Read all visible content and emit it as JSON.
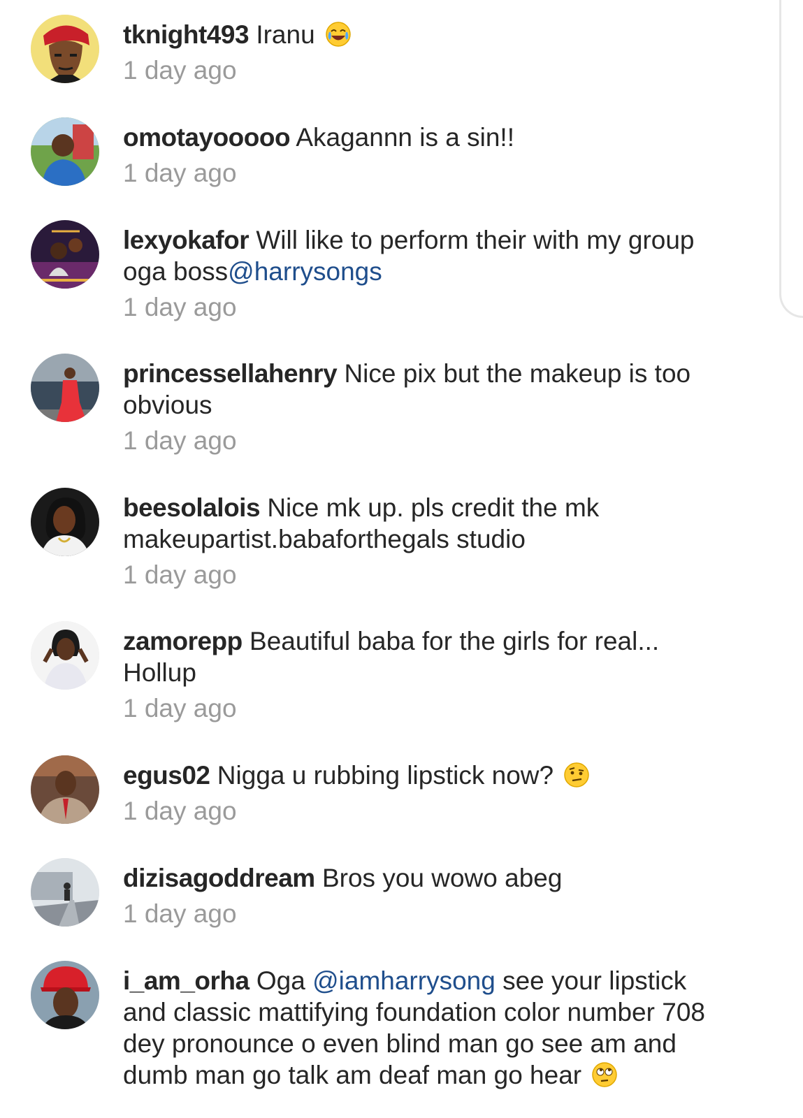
{
  "comments": [
    {
      "username": "tknight493",
      "text_before": "Iranu",
      "mention": "",
      "text_after": "",
      "emoji": "tears-of-joy-icon",
      "time": "1 day ago"
    },
    {
      "username": "omotayooooo",
      "text_before": "Akagannn is a sin!!",
      "mention": "",
      "text_after": "",
      "emoji": "",
      "time": "1 day ago"
    },
    {
      "username": "lexyokafor",
      "text_before": "Will like to perform their with my group oga boss",
      "mention": "@harrysongs",
      "text_after": "",
      "emoji": "",
      "time": "1 day ago"
    },
    {
      "username": "princessellahenry",
      "text_before": "Nice pix but the makeup is too obvious",
      "mention": "",
      "text_after": "",
      "emoji": "",
      "time": "1 day ago"
    },
    {
      "username": "beesolalois",
      "text_before": "Nice mk up. pls credit the mk makeupartist.babaforthegals studio",
      "mention": "",
      "text_after": "",
      "emoji": "",
      "time": "1 day ago"
    },
    {
      "username": "zamorepp",
      "text_before": "Beautiful baba for the girls for real... Hollup",
      "mention": "",
      "text_after": "",
      "emoji": "",
      "time": "1 day ago"
    },
    {
      "username": "egus02",
      "text_before": "Nigga u rubbing lipstick now?",
      "mention": "",
      "text_after": "",
      "emoji": "raised-eyebrow-icon",
      "time": "1 day ago"
    },
    {
      "username": "dizisagoddream",
      "text_before": "Bros you wowo abeg",
      "mention": "",
      "text_after": "",
      "emoji": "",
      "time": "1 day ago"
    },
    {
      "username": "i_am_orha",
      "text_before": "Oga",
      "mention": "@iamharrysong",
      "text_after": "see your lipstick and classic mattifying foundation color number 708 dey pronounce o even blind man go see am and dumb man go talk am deaf man go hear",
      "emoji": "rolling-eyes-icon",
      "time": ""
    }
  ],
  "colors": {
    "text": "#262626",
    "timestamp": "#9a9a9a",
    "mention": "#1f4e8c"
  }
}
